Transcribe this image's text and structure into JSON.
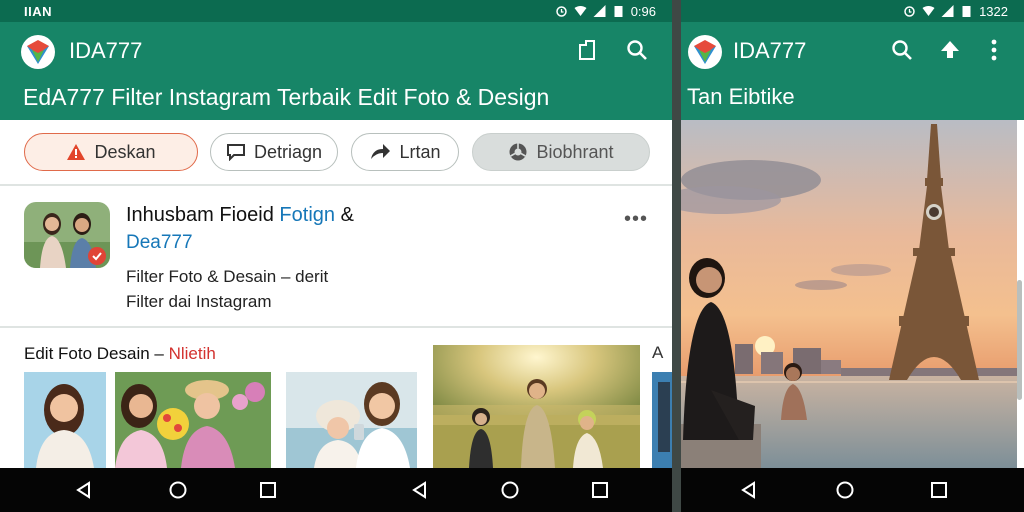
{
  "left": {
    "status": {
      "left_text": "IIAN",
      "time": "0:96"
    },
    "appbar": {
      "app_name": "IDA777",
      "subtitle": "EdA777 Filter Instagram Terbaik Edit Foto & Design"
    },
    "chips": [
      {
        "label": "Deskan",
        "icon": "warning-icon"
      },
      {
        "label": "Detriagn",
        "icon": "chat-icon"
      },
      {
        "label": "Lrtan",
        "icon": "share-icon"
      },
      {
        "label": "Biobhrant",
        "icon": "chrome-icon"
      }
    ],
    "card": {
      "title_a": "Inhusbam Fioeid ",
      "title_b": "Fotign",
      "title_c": " &",
      "title_line2": "Dea777",
      "desc_line1": "Filter Foto & Desain – derit",
      "desc_line2": "Filter dai Instagram",
      "more": "•••"
    },
    "gallery": {
      "heading": "Edit Foto Desain – ",
      "heading_red": "Nlietih",
      "edge_letter": "A"
    }
  },
  "right": {
    "status": {
      "time": "1322"
    },
    "appbar": {
      "app_name": "IDA777",
      "subtitle": "Tan Eibtike"
    }
  },
  "colors": {
    "appbar": "#178567",
    "statusbar": "#0c6b50",
    "accent_red": "#d3322f",
    "accent_blue": "#1677b8"
  }
}
